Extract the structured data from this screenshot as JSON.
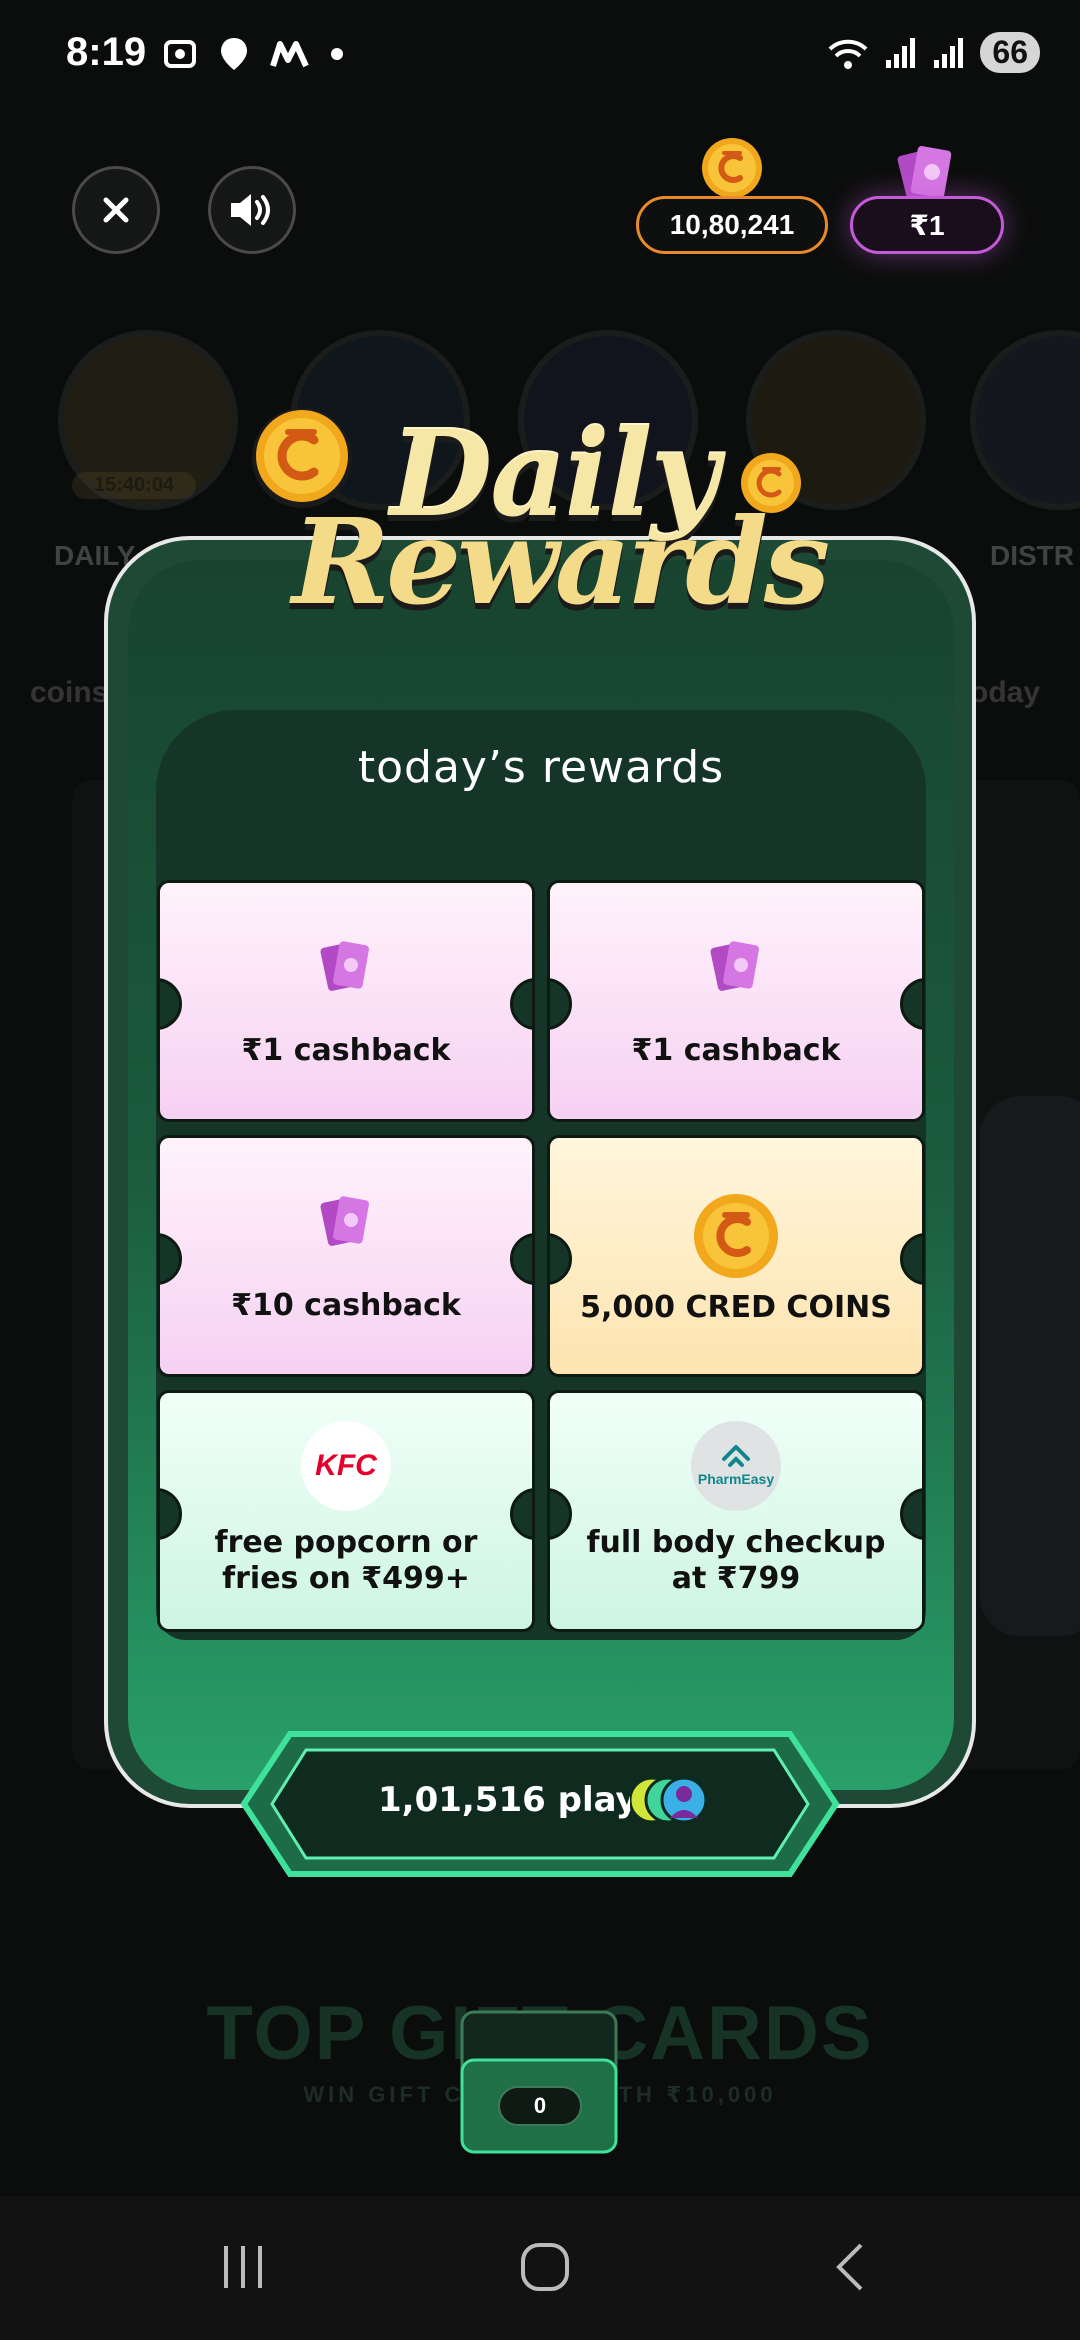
{
  "status_bar": {
    "time": "8:19",
    "left_icons": [
      "screenshot-icon",
      "maps-pin-icon",
      "m-icon",
      "dot-icon"
    ],
    "battery": "66"
  },
  "top": {
    "coins": "10,80,241",
    "cashback": "₹1"
  },
  "title": {
    "line1": "Daily",
    "line2": "Rewards"
  },
  "tray_title": "today’s rewards",
  "rewards": [
    {
      "label": "₹1 cashback",
      "icon": "cash-stack-icon",
      "style": "pink"
    },
    {
      "label": "₹1 cashback",
      "icon": "cash-stack-icon",
      "style": "pink"
    },
    {
      "label": "₹10 cashback",
      "icon": "cash-stack-icon",
      "style": "pink"
    },
    {
      "label": "5,000 CRED COINS",
      "icon": "cred-coin-icon",
      "style": "gold"
    },
    {
      "label_line1": "free popcorn or",
      "label_line2": "fries on ₹499+",
      "icon": "kfc-logo",
      "brand_text": "KFC",
      "style": "mint"
    },
    {
      "label_line1": "full body checkup",
      "label_line2": "at ₹799",
      "icon": "pharmeasy-logo",
      "brand_text": "PharmEasy",
      "style": "mint"
    }
  ],
  "played": "1,01,516 played",
  "background": {
    "timer": "15:40:04",
    "game_left_label": "DAILY",
    "game_right_label": "DISTR",
    "row_text_left": "coins",
    "row_text_right": "oday",
    "bottom_title": "TOP GIFT CARDS",
    "bottom_subtitle": "WIN GIFT CARDS WORTH ₹10,000"
  },
  "counter": "0",
  "colors": {
    "coin_pill_border": "#e98a2a",
    "cash_pill_border": "#c35bd6",
    "card_green": "#1b5c3d",
    "accent_mint": "#3ee29a",
    "title_gold": "#f3db8a"
  }
}
